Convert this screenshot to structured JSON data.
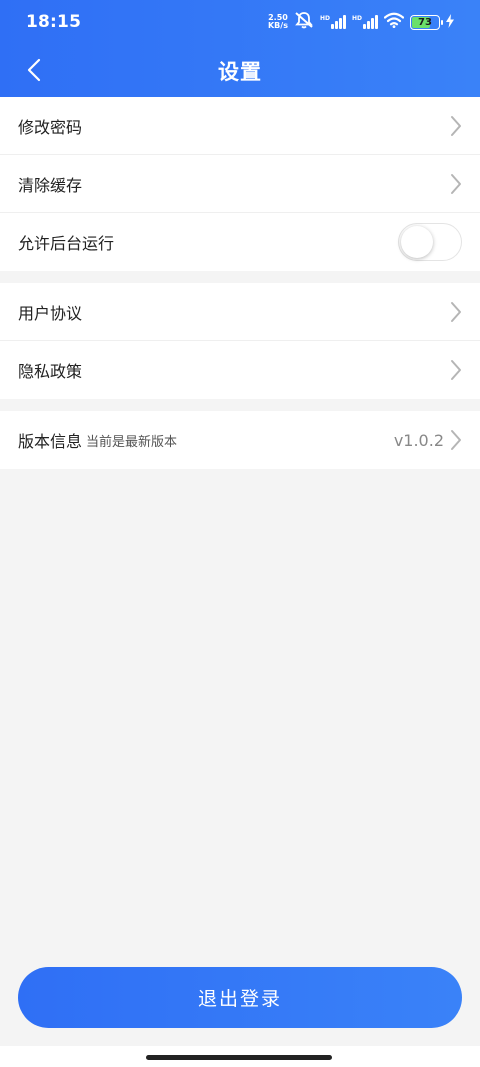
{
  "status_bar": {
    "time": "18:15",
    "net_speed_value": "2.50",
    "net_speed_unit": "KB/s",
    "hd1": "HD",
    "hd2": "HD",
    "battery_level": "73",
    "icons": [
      "mute-icon",
      "signal-icon",
      "signal-icon",
      "wifi-icon",
      "battery-icon",
      "charging-icon"
    ]
  },
  "nav": {
    "title": "设置",
    "back_icon": "chevron-left-icon"
  },
  "groups": [
    [
      {
        "label": "修改密码",
        "type": "arrow"
      },
      {
        "label": "清除缓存",
        "type": "arrow"
      },
      {
        "label": "允许后台运行",
        "type": "toggle",
        "enabled": false
      }
    ],
    [
      {
        "label": "用户协议",
        "type": "arrow"
      },
      {
        "label": "隐私政策",
        "type": "arrow"
      }
    ],
    [
      {
        "label": "版本信息",
        "sublabel": "当前是最新版本",
        "value": "v1.0.2",
        "type": "arrow"
      }
    ]
  ],
  "logout_label": "退出登录",
  "colors": {
    "primary": "#2f6ff5",
    "primary_light": "#3a82f8",
    "background": "#f4f4f4",
    "battery": "#6be06b"
  }
}
